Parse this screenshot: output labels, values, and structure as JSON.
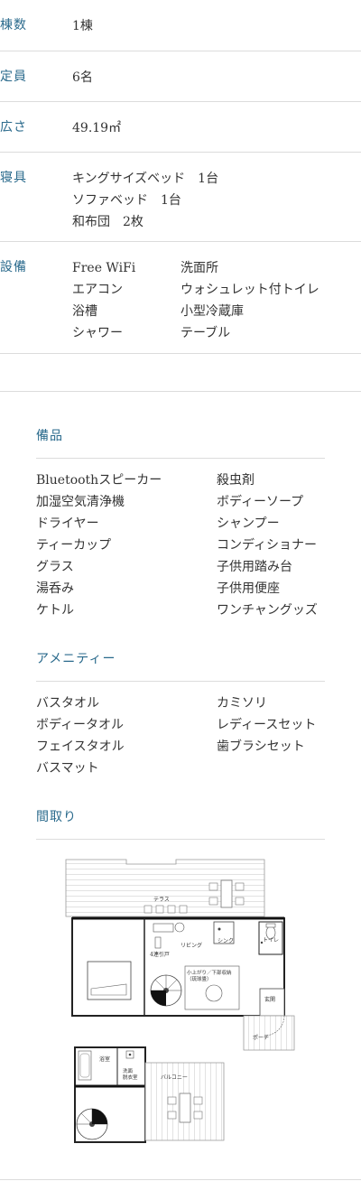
{
  "specs": {
    "building": {
      "label": "棟数",
      "value": "1棟"
    },
    "capacity": {
      "label": "定員",
      "value": "6名"
    },
    "area": {
      "label": "広さ",
      "value": "49.19㎡"
    },
    "bedding": {
      "label": "寝具",
      "lines": [
        "キングサイズベッド　1台",
        "ソファベッド　1台",
        "和布団　2枚"
      ]
    },
    "facilities": {
      "label": "設備",
      "col1": [
        "Free WiFi",
        "エアコン",
        "浴槽",
        "シャワー"
      ],
      "col2": [
        "洗面所",
        "ウォシュレット付トイレ",
        "小型冷蔵庫",
        "テーブル"
      ]
    }
  },
  "amenities_section": {
    "title": "備品",
    "col1": [
      "Bluetoothスピーカー",
      "加湿空気清浄機",
      "ドライヤー",
      "ティーカップ",
      "グラス",
      "湯呑み",
      "ケトル"
    ],
    "col2": [
      "殺虫剤",
      "ボディーソープ",
      "シャンプー",
      "コンディショナー",
      "子供用踏み台",
      "子供用便座",
      "ワンチャングッズ"
    ]
  },
  "toiletries_section": {
    "title": "アメニティー",
    "col1": [
      "バスタオル",
      "ボディータオル",
      "フェイスタオル",
      "バスマット"
    ],
    "col2": [
      "カミソリ",
      "レディースセット",
      "歯ブラシセット"
    ]
  },
  "floorplan_section": {
    "title": "間取り",
    "labels": {
      "terrace": "テラス",
      "living": "リビング",
      "sink": "シンク",
      "toilet": "トイレ",
      "sliding_door": "4連引戸",
      "raised_floor_1": "小上がり／下部収納",
      "raised_floor_2": "（琉球畳）",
      "entrance": "玄関",
      "porch": "ポーチ",
      "bathroom": "浴室",
      "washroom_1": "洗面",
      "washroom_2": "脱衣室",
      "balcony": "バルコニー"
    }
  }
}
